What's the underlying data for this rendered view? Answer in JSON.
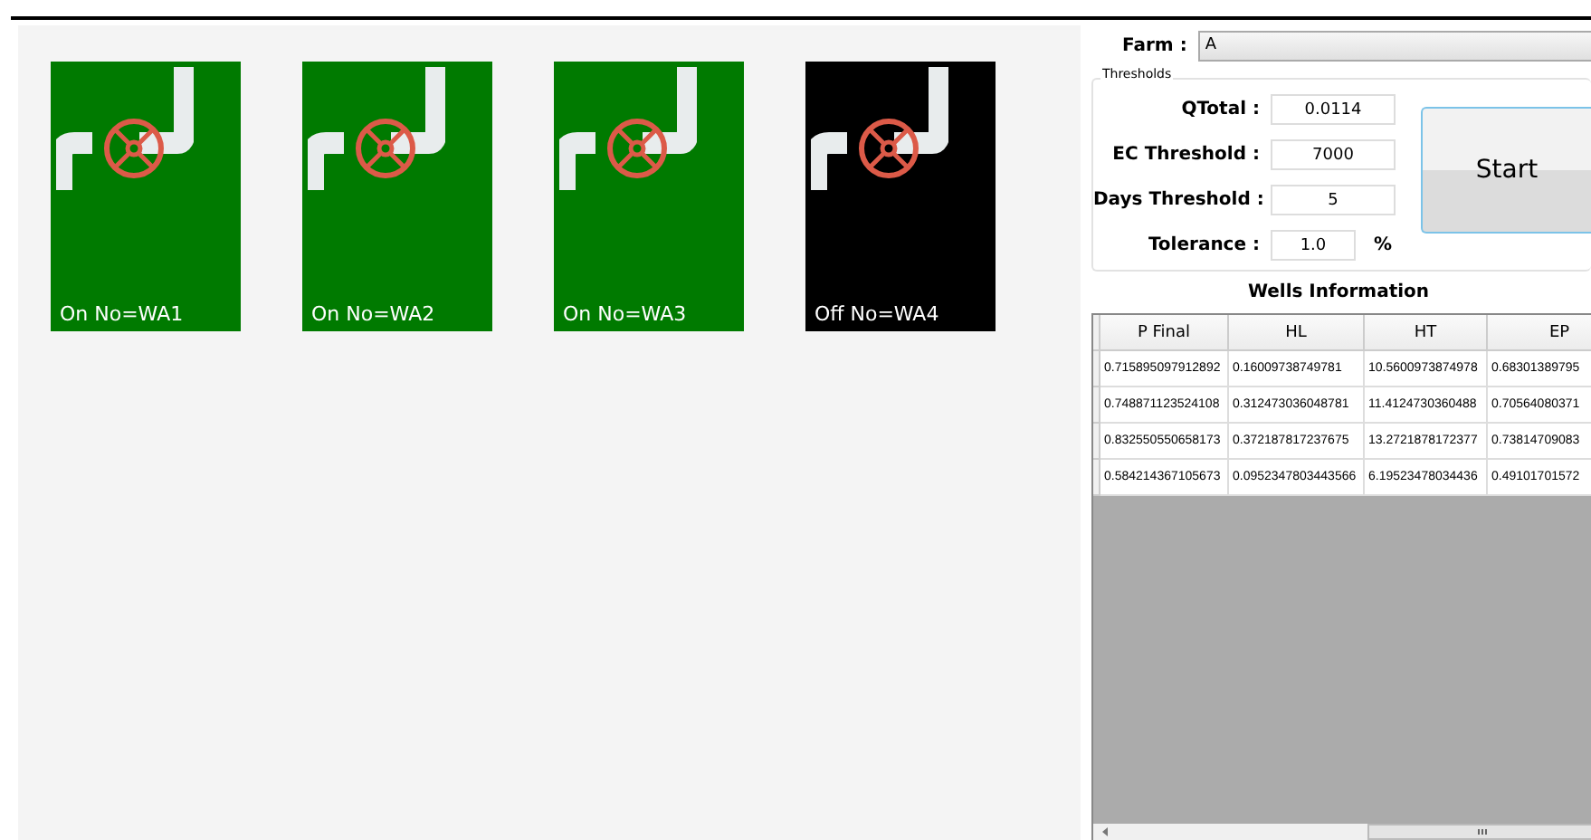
{
  "wells": [
    {
      "label": "On No=WA1",
      "on": true
    },
    {
      "label": "On No=WA2",
      "on": true
    },
    {
      "label": "On No=WA3",
      "on": true
    },
    {
      "label": "Off No=WA4",
      "on": false
    }
  ],
  "farm": {
    "label": "Farm :",
    "value": "A"
  },
  "thresholds": {
    "title": "Thresholds",
    "fields": [
      {
        "label": "QTotal :",
        "value": "0.0114"
      },
      {
        "label": "EC Threshold :",
        "value": "7000"
      },
      {
        "label": "Days Threshold :",
        "value": "5"
      },
      {
        "label": "Tolerance :",
        "value": "1.0",
        "unit": "%"
      }
    ],
    "start_button": "Start"
  },
  "table": {
    "title": "Wells Information",
    "columns": [
      "P Final",
      "HL",
      "HT",
      "EP"
    ],
    "rows": [
      [
        "0.715895097912892",
        "0.16009738749781",
        "10.5600973874978",
        "0.68301389795"
      ],
      [
        "0.748871123524108",
        "0.312473036048781",
        "11.4124730360488",
        "0.70564080371"
      ],
      [
        "0.832550550658173",
        "0.372187817237675",
        "13.2721878172377",
        "0.73814709083"
      ],
      [
        "0.584214367105673",
        "0.0952347803443566",
        "6.19523478034436",
        "0.49101701572"
      ]
    ]
  }
}
